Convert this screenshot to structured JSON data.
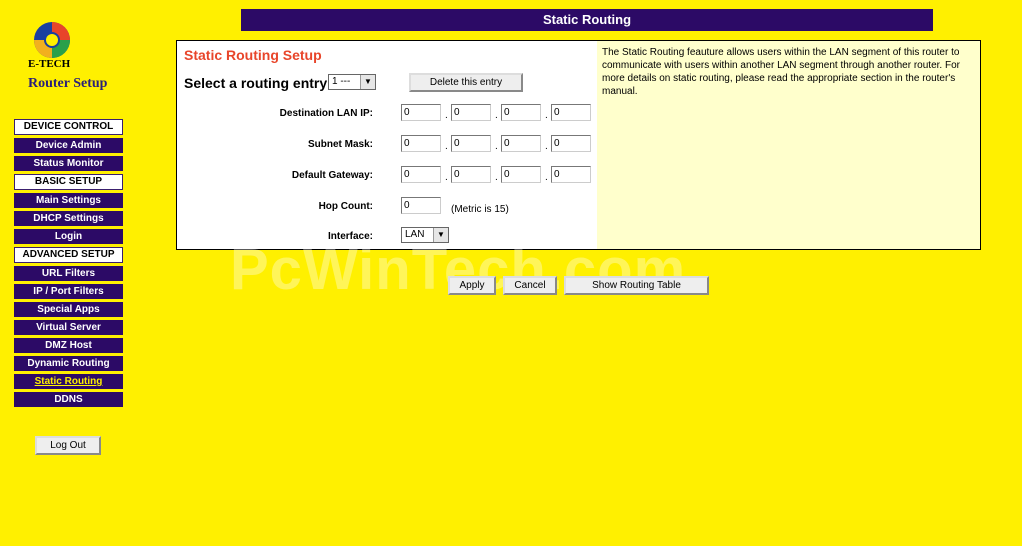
{
  "logo": {
    "brand": "E-TECH",
    "subtitle": "Router Setup"
  },
  "header": {
    "title": "Static Routing"
  },
  "sidebar": {
    "sections": [
      {
        "head": "DEVICE CONTROL",
        "items": [
          "Device Admin",
          "Status Monitor"
        ]
      },
      {
        "head": "BASIC SETUP",
        "items": [
          "Main Settings",
          "DHCP Settings",
          "Login"
        ]
      },
      {
        "head": "ADVANCED SETUP",
        "items": [
          "URL Filters",
          "IP / Port Filters",
          "Special Apps",
          "Virtual Server",
          "DMZ Host",
          "Dynamic Routing",
          "Static Routing",
          "DDNS"
        ]
      }
    ],
    "logout": "Log Out"
  },
  "setup": {
    "title": "Static Routing Setup",
    "select_label": "Select a routing entry:",
    "select_value": "1 ---",
    "delete_label": "Delete this entry",
    "dest_label": "Destination LAN IP:",
    "dest": [
      "0",
      "0",
      "0",
      "0"
    ],
    "mask_label": "Subnet Mask:",
    "mask": [
      "0",
      "0",
      "0",
      "0"
    ],
    "gw_label": "Default Gateway:",
    "gw": [
      "0",
      "0",
      "0",
      "0"
    ],
    "hop_label": "Hop Count:",
    "hop_value": "0",
    "hop_note": "(Metric is 15)",
    "iface_label": "Interface:",
    "iface_value": "LAN",
    "dot": "."
  },
  "help": {
    "text": "The Static Routing feauture allows users within the LAN segment of this router to communicate with users within another LAN segment through another router. For more details on static routing, please read the appropriate section in the router's manual."
  },
  "buttons": {
    "apply": "Apply",
    "cancel": "Cancel",
    "show_table": "Show Routing Table"
  },
  "watermark": "PcWinTech.com",
  "colors": {
    "background": "#FFF000",
    "nav": "#2C0A66",
    "title_accent": "#E8452A",
    "help_bg": "#FFFFCC"
  }
}
